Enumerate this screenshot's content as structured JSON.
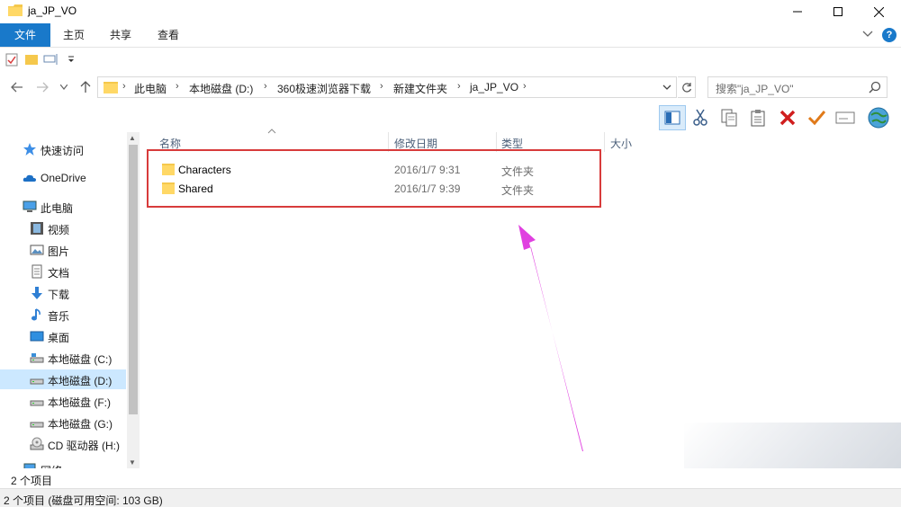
{
  "window": {
    "title": "ja_JP_VO"
  },
  "ribbon": {
    "tabs": [
      "文件",
      "主页",
      "共享",
      "查看"
    ],
    "help_label": "?"
  },
  "address": {
    "crumbs": [
      "此电脑",
      "本地磁盘 (D:)",
      "360极速浏览器下载",
      "新建文件夹",
      "ja_JP_VO"
    ],
    "search_placeholder": "搜索\"ja_JP_VO\""
  },
  "sidebar": {
    "items": [
      {
        "label": "快速访问",
        "icon": "star-icon"
      },
      {
        "label": "OneDrive",
        "icon": "cloud-icon"
      },
      {
        "label": "此电脑",
        "icon": "computer-icon"
      },
      {
        "label": "视频",
        "icon": "video-icon"
      },
      {
        "label": "图片",
        "icon": "pictures-icon"
      },
      {
        "label": "文档",
        "icon": "documents-icon"
      },
      {
        "label": "下载",
        "icon": "download-icon"
      },
      {
        "label": "音乐",
        "icon": "music-icon"
      },
      {
        "label": "桌面",
        "icon": "desktop-icon"
      },
      {
        "label": "本地磁盘 (C:)",
        "icon": "drive-c-icon"
      },
      {
        "label": "本地磁盘 (D:)",
        "icon": "drive-d-icon"
      },
      {
        "label": "本地磁盘 (F:)",
        "icon": "drive-f-icon"
      },
      {
        "label": "本地磁盘 (G:)",
        "icon": "drive-g-icon"
      },
      {
        "label": "CD 驱动器 (H:)",
        "icon": "cd-drive-icon"
      },
      {
        "label": "网络",
        "icon": "network-icon"
      }
    ],
    "selected": "本地磁盘 (D:)"
  },
  "columns": {
    "name": "名称",
    "modified": "修改日期",
    "type": "类型",
    "size": "大小"
  },
  "files": [
    {
      "name": "Characters",
      "modified": "2016/1/7 9:31",
      "type": "文件夹"
    },
    {
      "name": "Shared",
      "modified": "2016/1/7 9:39",
      "type": "文件夹"
    }
  ],
  "status": {
    "item_count": "2 个项目",
    "disk_info": "2 个项目 (磁盘可用空间: 103 GB)"
  },
  "colors": {
    "accent": "#1979ca",
    "highlight_box": "#d83b3b",
    "arrow": "#e040e0",
    "folder": "#f5c84c"
  }
}
